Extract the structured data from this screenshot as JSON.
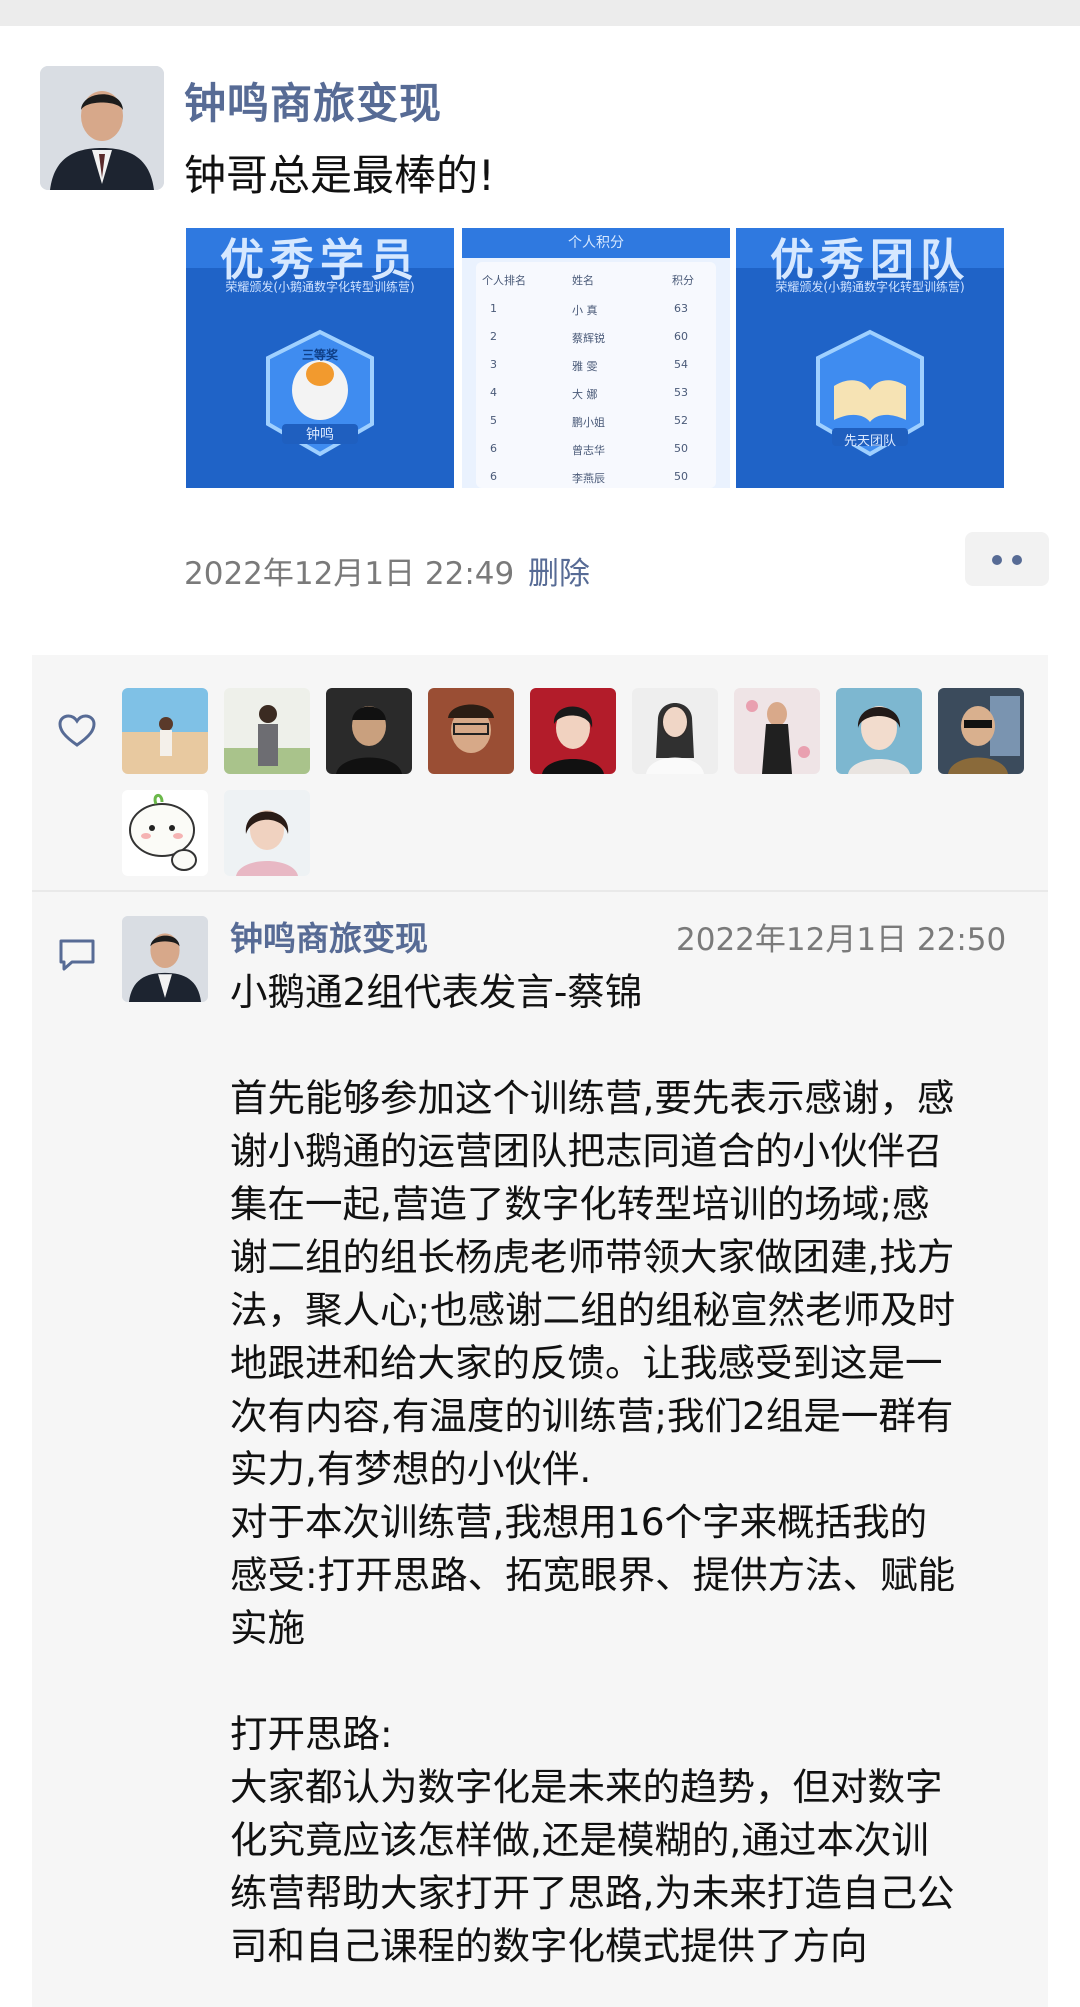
{
  "post": {
    "author": "钟鸣商旅变现",
    "text": "钟哥总是最棒的!",
    "images": [
      {
        "title": "优秀学员",
        "subtitle": "荣耀颁发(小鹅通数字化转型训练营)",
        "badge_text": "三等奖",
        "badge_name": "钟鸣"
      },
      {
        "title": "个人积分",
        "headers": [
          "个人排名",
          "姓名",
          "积分"
        ],
        "rows": [
          [
            "1",
            "小 真",
            "63"
          ],
          [
            "2",
            "蔡辉锐",
            "60"
          ],
          [
            "3",
            "雅 雯",
            "54"
          ],
          [
            "4",
            "大 娜",
            "53"
          ],
          [
            "5",
            "鹏小姐",
            "52"
          ],
          [
            "6",
            "曾志华",
            "50"
          ],
          [
            "6",
            "李燕辰",
            "50"
          ]
        ]
      },
      {
        "title": "优秀团队",
        "subtitle": "荣耀颁发(小鹅通数字化转型训练营)",
        "badge_name": "先天团队"
      }
    ],
    "timestamp": "2022年12月1日 22:49",
    "delete_label": "删除"
  },
  "likes": {
    "count": 11
  },
  "comment": {
    "author": "钟鸣商旅变现",
    "timestamp": "2022年12月1日 22:50",
    "lines": [
      "小鹅通2组代表发言-蔡锦",
      "",
      "首先能够参加这个训练营,要先表示感谢，感",
      "谢小鹅通的运营团队把志同道合的小伙伴召",
      "集在一起,营造了数字化转型培训的场域;感",
      "谢二组的组长杨虎老师带领大家做团建,找方",
      "法，聚人心;也感谢二组的组秘宣然老师及时",
      "地跟进和给大家的反馈。让我感受到这是一",
      "次有内容,有温度的训练营;我们2组是一群有",
      "实力,有梦想的小伙伴.",
      "对于本次训练营,我想用16个字来概括我的",
      "感受:打开思路、拓宽眼界、提供方法、赋能",
      "实施",
      "",
      "打开思路:",
      "大家都认为数字化是未来的趋势，但对数字",
      "化究竟应该怎样做,还是模糊的,通过本次训",
      "练营帮助大家打开了思路,为未来打造自己公",
      "司和自己课程的数字化模式提供了方向"
    ]
  },
  "colors": {
    "link": "#576b95",
    "meta": "#7a7a7a",
    "panel": "#f6f6f6",
    "poster_blue": "#1f63c7"
  }
}
